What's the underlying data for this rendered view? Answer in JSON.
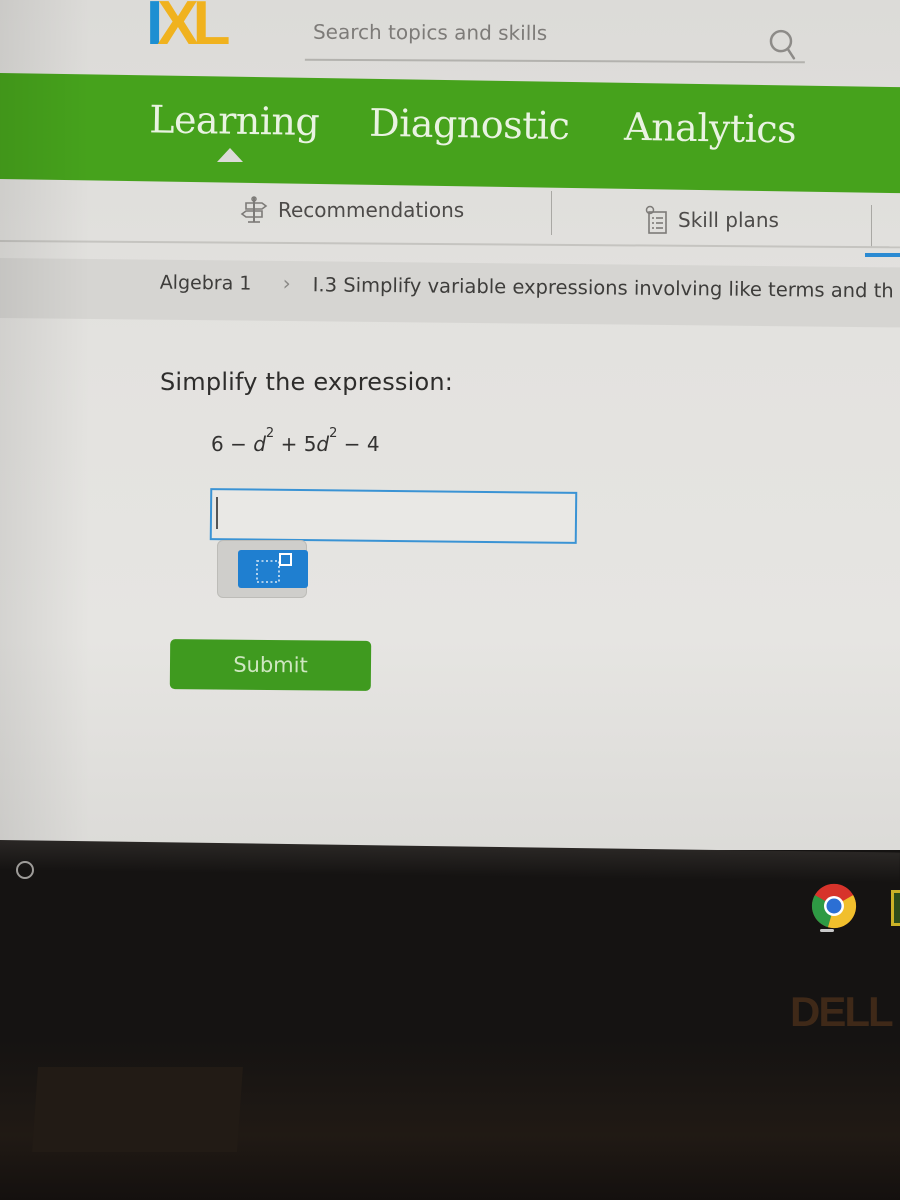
{
  "header": {
    "logo": {
      "i": "I",
      "x": "X",
      "l": "L"
    },
    "search": {
      "placeholder": "Search topics and skills",
      "value": "",
      "icon": "search-icon"
    }
  },
  "nav": {
    "tabs": [
      {
        "label": "Learning",
        "active": true
      },
      {
        "label": "Diagnostic",
        "active": false
      },
      {
        "label": "Analytics",
        "active": false
      }
    ]
  },
  "subnav": {
    "items": [
      {
        "label": "Recommendations",
        "icon": "signpost-icon"
      },
      {
        "label": "Skill plans",
        "icon": "checklist-icon"
      }
    ]
  },
  "breadcrumb": {
    "root": "Algebra 1",
    "separator": "›",
    "current": "I.3 Simplify variable expressions involving like terms and th"
  },
  "question": {
    "prompt": "Simplify the expression:",
    "expression": {
      "term1": "6",
      "op1": "−",
      "var1": "d",
      "exp1": "2",
      "op2": "+",
      "coef2": "5",
      "var2": "d",
      "exp2": "2",
      "op3": "−",
      "term4": "4"
    },
    "answer": {
      "value": "",
      "placeholder": ""
    },
    "math_keyboard_icon": "exponent-template-icon",
    "submit_label": "Submit"
  },
  "device": {
    "brand": "DELL",
    "shelf_apps": [
      "chrome-icon",
      "app-icon"
    ]
  },
  "colors": {
    "nav_green": "#46a21c",
    "submit_green": "#3f9a1f",
    "input_border_blue": "#3a93d4",
    "logo_blue": "#1d8fd2",
    "logo_yellow": "#f0b21e"
  }
}
